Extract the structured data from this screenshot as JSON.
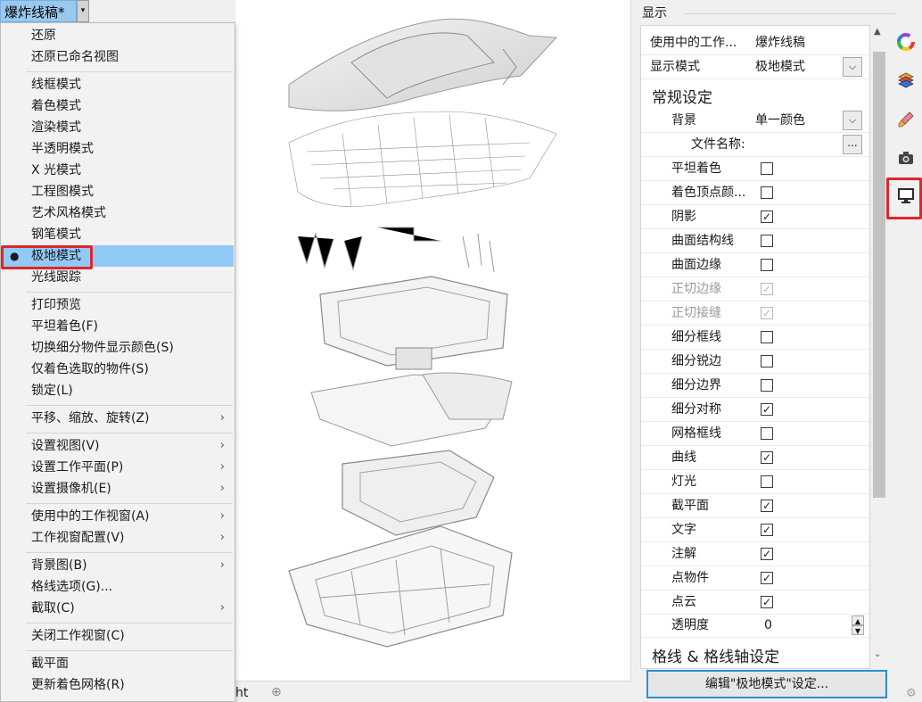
{
  "viewport": {
    "title": "爆炸线稿*",
    "title_arrow": "▾",
    "tab_tail": "ht",
    "add_tab": "⊕"
  },
  "menu": {
    "items": [
      {
        "label": "还原"
      },
      {
        "label": "还原已命名视图"
      },
      {
        "label": "线框模式"
      },
      {
        "label": "着色模式"
      },
      {
        "label": "渲染模式"
      },
      {
        "label": "半透明模式"
      },
      {
        "label": "X 光模式"
      },
      {
        "label": "工程图模式"
      },
      {
        "label": "艺术风格模式"
      },
      {
        "label": "钢笔模式"
      },
      {
        "label": "极地模式",
        "selected": true
      },
      {
        "label": "光线跟踪"
      },
      {
        "label": "打印预览"
      },
      {
        "label": "平坦着色(F)"
      },
      {
        "label": "切换细分物件显示颜色(S)"
      },
      {
        "label": "仅着色选取的物件(S)"
      },
      {
        "label": "锁定(L)"
      },
      {
        "label": "平移、缩放、旋转(Z)",
        "submenu": true
      },
      {
        "label": "设置视图(V)",
        "submenu": true
      },
      {
        "label": "设置工作平面(P)",
        "submenu": true
      },
      {
        "label": "设置摄像机(E)",
        "submenu": true
      },
      {
        "label": "使用中的工作视窗(A)",
        "submenu": true
      },
      {
        "label": "工作视窗配置(V)",
        "submenu": true
      },
      {
        "label": "背景图(B)",
        "submenu": true
      },
      {
        "label": "格线选项(G)..."
      },
      {
        "label": "截取(C)",
        "submenu": true
      },
      {
        "label": "关闭工作视窗(C)"
      },
      {
        "label": "截平面"
      },
      {
        "label": "更新着色网格(R)"
      }
    ],
    "bullet": "●",
    "submenu_arrow": "›"
  },
  "panel": {
    "header": "显示",
    "active_viewport_label": "使用中的工作...",
    "active_viewport_value": "爆炸线稿",
    "display_mode_label": "显示模式",
    "display_mode_value": "极地模式",
    "general_section": "常规设定",
    "background_label": "背景",
    "background_value": "单一颜色",
    "filename_label": "文件名称:",
    "filename_value": "",
    "browse": "...",
    "dropdown_arrow": "⌵",
    "options": [
      {
        "label": "平坦着色",
        "checked": false,
        "disabled": false
      },
      {
        "label": "着色顶点颜...",
        "checked": false,
        "disabled": false
      },
      {
        "label": "阴影",
        "checked": true,
        "disabled": false
      },
      {
        "label": "曲面结构线",
        "checked": false,
        "disabled": false
      },
      {
        "label": "曲面边缘",
        "checked": false,
        "disabled": false
      },
      {
        "label": "正切边缘",
        "checked": true,
        "disabled": true
      },
      {
        "label": "正切接缝",
        "checked": true,
        "disabled": true
      },
      {
        "label": "细分框线",
        "checked": false,
        "disabled": false
      },
      {
        "label": "细分锐边",
        "checked": false,
        "disabled": false
      },
      {
        "label": "细分边界",
        "checked": false,
        "disabled": false
      },
      {
        "label": "细分对称",
        "checked": true,
        "disabled": false
      },
      {
        "label": "网格框线",
        "checked": false,
        "disabled": false
      },
      {
        "label": "曲线",
        "checked": true,
        "disabled": false
      },
      {
        "label": "灯光",
        "checked": false,
        "disabled": false
      },
      {
        "label": "截平面",
        "checked": true,
        "disabled": false
      },
      {
        "label": "文字",
        "checked": true,
        "disabled": false
      },
      {
        "label": "注解",
        "checked": true,
        "disabled": false
      },
      {
        "label": "点物件",
        "checked": true,
        "disabled": false
      },
      {
        "label": "点云",
        "checked": true,
        "disabled": false
      }
    ],
    "check_glyph": "✓",
    "transparency_label": "透明度",
    "transparency_value": "0",
    "spin_up": "▲",
    "spin_down": "▼",
    "grid_section": "格线 & 格线轴设定",
    "edit_button": "编辑\"极地模式\"设定...",
    "scroll_up": "▲",
    "scroll_down": "⌄"
  },
  "toolbar": {
    "icons": [
      "color-wheel-icon",
      "layers-icon",
      "material-brush-icon",
      "camera-icon",
      "display-monitor-icon"
    ],
    "active": "display-monitor-icon",
    "gear": "⚙"
  },
  "colors": {
    "selection": "#91c9f7",
    "highlight": "#e0252a",
    "accent_border": "#2a8fd4"
  }
}
